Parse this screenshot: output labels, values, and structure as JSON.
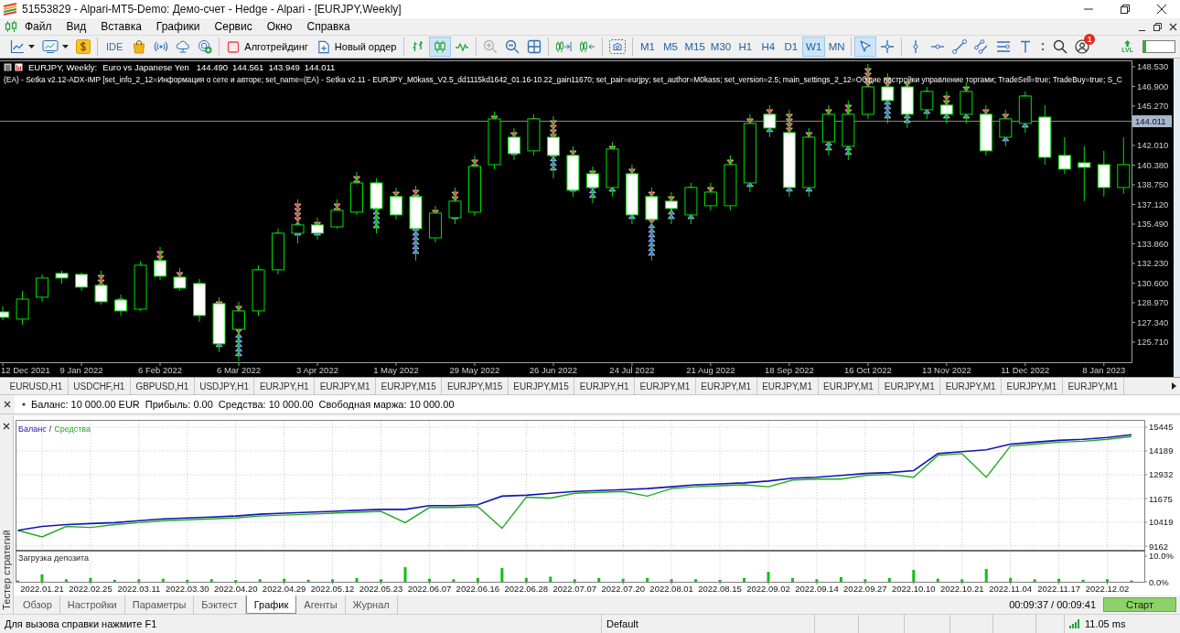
{
  "window": {
    "title": "51553829 - Alpari-MT5-Demo: Демо-счет - Hedge - Alpari - [EURJPY,Weekly]"
  },
  "menu": [
    "Файл",
    "Вид",
    "Вставка",
    "Графики",
    "Сервис",
    "Окно",
    "Справка"
  ],
  "toolbar": {
    "ide_label": "IDE",
    "algo_trading": {
      "label": "Алготрейдинг",
      "on": false
    },
    "new_order": "Новый ордер",
    "chart_types": [
      {
        "kind": "bars",
        "selected": false
      },
      {
        "kind": "candles",
        "selected": true
      },
      {
        "kind": "line",
        "selected": false
      }
    ],
    "zoom": [
      {
        "kind": "zoom_in",
        "disabled": true
      },
      {
        "kind": "zoom_out",
        "disabled": false
      }
    ],
    "timeframes": [
      {
        "label": "M1",
        "selected": false
      },
      {
        "label": "M5",
        "selected": false
      },
      {
        "label": "M15",
        "selected": false
      },
      {
        "label": "M30",
        "selected": false
      },
      {
        "label": "H1",
        "selected": false
      },
      {
        "label": "H4",
        "selected": false
      },
      {
        "label": "D1",
        "selected": false
      },
      {
        "label": "W1",
        "selected": true
      },
      {
        "label": "MN",
        "selected": false
      }
    ],
    "tools": [
      {
        "kind": "cursor",
        "selected": true
      },
      {
        "kind": "crosshair",
        "selected": false
      }
    ],
    "notification_badge": "1",
    "lvl_label": "LVL",
    "meter": {
      "level": 0.08
    }
  },
  "chart": {
    "header": {
      "symbol": "EURJPY, Weekly:",
      "description": "Euro vs Japanese Yen",
      "prices": [
        "144.490",
        "144.561",
        "143.949",
        "144.011"
      ]
    },
    "expert_info": "(EA) - Setka v2.12-ADX-IMP [set_info_2_12=Информация о сете и авторе; set_name=(EA) - Setka v2.11 - EURJPY_M0kass_V2.5_dd1115kd1642_01.16-10.22_gain11670; set_pair=eurjpy; set_author=M0kass; set_version=2.5; main_settings_2_12=Общие настройки управление торгами; TradeSell=true; TradeBuy=true; S_C",
    "trade_markers": [
      false,
      false,
      false,
      false,
      false,
      true,
      true,
      true,
      true,
      true,
      true,
      true,
      true,
      true,
      true,
      true,
      true,
      true,
      true,
      true,
      true,
      true,
      true,
      true,
      true,
      true,
      true,
      true,
      true,
      true,
      true,
      true,
      true,
      true,
      true,
      true,
      true,
      true,
      true,
      true,
      true,
      true,
      true,
      true,
      true,
      true,
      true,
      true,
      true,
      true,
      true,
      true,
      true,
      false,
      false,
      false,
      false,
      false
    ],
    "chart_data": [
      {
        "type": "candlestick",
        "x": [
          "2021-12-12",
          "2021-12-19",
          "2021-12-26",
          "2022-01-02",
          "2022-01-09",
          "2022-01-16",
          "2022-01-23",
          "2022-01-30",
          "2022-02-06",
          "2022-02-13",
          "2022-02-20",
          "2022-02-27",
          "2022-03-06",
          "2022-03-13",
          "2022-03-20",
          "2022-03-27",
          "2022-04-03",
          "2022-04-10",
          "2022-04-17",
          "2022-04-24",
          "2022-05-01",
          "2022-05-08",
          "2022-05-15",
          "2022-05-22",
          "2022-05-29",
          "2022-06-05",
          "2022-06-12",
          "2022-06-19",
          "2022-06-26",
          "2022-07-03",
          "2022-07-10",
          "2022-07-17",
          "2022-07-24",
          "2022-07-31",
          "2022-08-07",
          "2022-08-14",
          "2022-08-21",
          "2022-08-28",
          "2022-09-04",
          "2022-09-11",
          "2022-09-18",
          "2022-09-25",
          "2022-10-02",
          "2022-10-09",
          "2022-10-16",
          "2022-10-23",
          "2022-10-30",
          "2022-11-06",
          "2022-11-13",
          "2022-11-20",
          "2022-11-27",
          "2022-12-04",
          "2022-12-11",
          "2022-12-18",
          "2022-12-25",
          "2023-01-01",
          "2023-01-08",
          "2023-01-15"
        ],
        "ohlc": [
          [
            128.21,
            128.67,
            127.53,
            127.76
          ],
          [
            127.61,
            129.96,
            127.15,
            129.27
          ],
          [
            129.43,
            131.32,
            129.05,
            131.02
          ],
          [
            131.4,
            131.62,
            130.56,
            131.02
          ],
          [
            131.32,
            131.47,
            129.96,
            130.26
          ],
          [
            130.41,
            131.62,
            128.82,
            129.05
          ],
          [
            129.2,
            129.65,
            127.91,
            128.29
          ],
          [
            128.44,
            132.38,
            128.29,
            132.08
          ],
          [
            132.46,
            133.6,
            130.87,
            131.17
          ],
          [
            131.09,
            131.85,
            129.96,
            130.18
          ],
          [
            130.56,
            130.94,
            127.38,
            127.91
          ],
          [
            128.9,
            129.43,
            124.88,
            125.56
          ],
          [
            126.77,
            129.05,
            124.12,
            128.29
          ],
          [
            128.29,
            132.08,
            127.91,
            131.7
          ],
          [
            131.7,
            135.11,
            131.32,
            134.73
          ],
          [
            134.73,
            137.54,
            133.9,
            135.42
          ],
          [
            135.42,
            136.02,
            134.2,
            134.73
          ],
          [
            135.26,
            137.54,
            135.11,
            136.63
          ],
          [
            136.48,
            139.81,
            136.25,
            138.9
          ],
          [
            138.9,
            139.28,
            134.73,
            136.78
          ],
          [
            137.77,
            138.52,
            135.87,
            136.25
          ],
          [
            137.77,
            138.67,
            132.46,
            135.11
          ],
          [
            134.35,
            137.01,
            133.97,
            136.4
          ],
          [
            136.02,
            138.52,
            135.49,
            137.39
          ],
          [
            136.48,
            141.18,
            136.17,
            140.27
          ],
          [
            140.42,
            144.82,
            140.04,
            144.21
          ],
          [
            142.69,
            143.45,
            140.8,
            141.33
          ],
          [
            141.56,
            144.59,
            141.18,
            144.21
          ],
          [
            142.69,
            144.44,
            139.28,
            141.18
          ],
          [
            141.18,
            141.94,
            137.77,
            138.3
          ],
          [
            139.66,
            140.27,
            137.23,
            138.52
          ],
          [
            138.52,
            142.31,
            137.77,
            141.71
          ],
          [
            139.66,
            140.42,
            135.49,
            136.25
          ],
          [
            137.77,
            138.52,
            132.46,
            135.87
          ],
          [
            137.39,
            138.14,
            135.49,
            136.78
          ],
          [
            136.25,
            138.9,
            135.49,
            138.52
          ],
          [
            137.01,
            138.9,
            136.63,
            138.14
          ],
          [
            137.01,
            141.18,
            136.63,
            140.42
          ],
          [
            138.9,
            144.59,
            138.14,
            143.83
          ],
          [
            144.59,
            145.35,
            142.69,
            143.45
          ],
          [
            143.07,
            144.97,
            137.77,
            138.52
          ],
          [
            138.52,
            143.45,
            137.77,
            142.69
          ],
          [
            142.31,
            145.35,
            141.18,
            144.59
          ],
          [
            141.94,
            145.73,
            140.8,
            144.59
          ],
          [
            144.59,
            148.76,
            144.21,
            146.86
          ],
          [
            146.86,
            148.0,
            143.83,
            145.73
          ],
          [
            146.86,
            147.62,
            143.45,
            144.59
          ],
          [
            144.97,
            146.86,
            144.21,
            146.48
          ],
          [
            145.35,
            146.48,
            143.83,
            144.59
          ],
          [
            144.59,
            147.24,
            143.83,
            146.48
          ],
          [
            144.59,
            145.35,
            141.18,
            141.56
          ],
          [
            142.69,
            144.97,
            141.94,
            144.21
          ],
          [
            143.83,
            146.48,
            143.07,
            146.1
          ],
          [
            144.36,
            145.35,
            140.42,
            141.02
          ],
          [
            141.18,
            142.69,
            139.66,
            140.04
          ],
          [
            140.57,
            141.94,
            137.39,
            140.19
          ],
          [
            140.42,
            141.56,
            137.77,
            138.52
          ],
          [
            138.52,
            142.69,
            137.99,
            140.42
          ]
        ],
        "xlim": [
          "2021-12-11",
          "2023-01-18"
        ],
        "ylim": [
          124.0,
          149.02
        ],
        "yticks": [
          {
            "value": 148.53,
            "label": "148.530"
          },
          {
            "value": 146.9,
            "label": "146.900"
          },
          {
            "value": 145.27,
            "label": "145.270"
          },
          {
            "value": 142.01,
            "label": "142.010"
          },
          {
            "value": 140.38,
            "label": "140.380"
          },
          {
            "value": 138.75,
            "label": "138.750"
          },
          {
            "value": 137.12,
            "label": "137.120"
          },
          {
            "value": 135.49,
            "label": "135.490"
          },
          {
            "value": 133.86,
            "label": "133.860"
          },
          {
            "value": 132.23,
            "label": "132.230"
          },
          {
            "value": 130.6,
            "label": "130.600"
          },
          {
            "value": 128.97,
            "label": "128.970"
          },
          {
            "value": 127.34,
            "label": "127.340"
          },
          {
            "value": 125.71,
            "label": "125.710"
          }
        ],
        "xticks": [
          {
            "value": "2021-12-12",
            "label": "12 Dec 2021"
          },
          {
            "value": "2022-01-09",
            "label": "9 Jan 2022"
          },
          {
            "value": "2022-02-06",
            "label": "6 Feb 2022"
          },
          {
            "value": "2022-03-06",
            "label": "6 Mar 2022"
          },
          {
            "value": "2022-04-03",
            "label": "3 Apr 2022"
          },
          {
            "value": "2022-05-01",
            "label": "1 May 2022"
          },
          {
            "value": "2022-05-29",
            "label": "29 May 2022"
          },
          {
            "value": "2022-06-26",
            "label": "26 Jun 2022"
          },
          {
            "value": "2022-07-24",
            "label": "24 Jul 2022"
          },
          {
            "value": "2022-08-21",
            "label": "21 Aug 2022"
          },
          {
            "value": "2022-09-18",
            "label": "18 Sep 2022"
          },
          {
            "value": "2022-10-16",
            "label": "16 Oct 2022"
          },
          {
            "value": "2022-11-13",
            "label": "13 Nov 2022"
          },
          {
            "value": "2022-12-11",
            "label": "11 Dec 2022"
          },
          {
            "value": "2023-01-08",
            "label": "8 Jan 2023"
          }
        ],
        "ref_lines": [
          {
            "axis": "y",
            "value": 144.011,
            "label": "144.011",
            "color": "#8c8c8c"
          }
        ]
      }
    ]
  },
  "symbol_tabs": [
    "EURUSD,H1",
    "USDCHF,H1",
    "GBPUSD,H1",
    "USDJPY,H1",
    "EURJPY,H1",
    "EURJPY,M1",
    "EURJPY,M15",
    "EURJPY,M15",
    "EURJPY,M15",
    "EURJPY,H1",
    "EURJPY,M1",
    "EURJPY,M1",
    "EURJPY,M1",
    "EURJPY,M1",
    "EURJPY,M1",
    "EURJPY,M1",
    "EURJPY,M1",
    "EURJPY,M1"
  ],
  "account": [
    "Баланс: 10 000.00 EUR",
    "Прибыль: 0.00",
    "Средства: 10 000.00",
    "Свободная маржа: 10 000.00"
  ],
  "tester": {
    "title": "Тестер стратегий",
    "legend_separator": "/",
    "chart_data": [
      {
        "type": "line",
        "tick_labels": "y",
        "grid": true,
        "series": [
          {
            "name": "Баланс",
            "color": "#1414b4",
            "values": [
              10000,
              10200,
              10300,
              10350,
              10400,
              10500,
              10600,
              10650,
              10700,
              10750,
              10850,
              10900,
              10950,
              11000,
              11050,
              11100,
              11100,
              11300,
              11300,
              11350,
              11800,
              11850,
              11950,
              12050,
              12100,
              12150,
              12200,
              12300,
              12400,
              12450,
              12500,
              12600,
              12750,
              12800,
              12900,
              13000,
              13050,
              13150,
              14050,
              14150,
              14250,
              14550,
              14650,
              14750,
              14800,
              14900,
              15050
            ]
          },
          {
            "name": "Средства",
            "color": "#22aa22",
            "values": [
              10000,
              9650,
              10200,
              10150,
              10300,
              10400,
              10500,
              10550,
              10600,
              10650,
              10750,
              10800,
              10850,
              10900,
              10950,
              11000,
              10400,
              11200,
              11200,
              11250,
              10100,
              11750,
              11700,
              11950,
              12000,
              12050,
              11800,
              12200,
              12300,
              12350,
              12400,
              12300,
              12650,
              12700,
              12700,
              12900,
              12950,
              12800,
              13950,
              14050,
              12800,
              14450,
              14550,
              14650,
              14700,
              14800,
              14950
            ]
          }
        ],
        "ylim": [
          8969,
          15807
        ],
        "yticks": [
          9162,
          10419,
          11675,
          12932,
          14189,
          15445
        ]
      },
      {
        "type": "bar",
        "title": "Загрузка депозита",
        "color": "#10c010",
        "grid": true,
        "categories": [
          null,
          "2022.01.21",
          null,
          "2022.02.25",
          null,
          "2022.03.11",
          null,
          "2022.03.30",
          null,
          "2022.04.20",
          null,
          "2022.04.29",
          null,
          "2022.05.12",
          null,
          "2022.05.23",
          null,
          "2022.06.07",
          null,
          "2022.06.16",
          null,
          "2022.06.28",
          null,
          "2022.07.07",
          null,
          "2022.07.20",
          null,
          "2022.08.01",
          null,
          "2022.08.15",
          null,
          "2022.09.02",
          null,
          "2022.09.14",
          null,
          "2022.09.27",
          null,
          "2022.10.10",
          null,
          "2022.10.21",
          null,
          "2022.11.04",
          null,
          "2022.11.17",
          null,
          "2022.12.02",
          null
        ],
        "values": [
          0.5,
          2.9,
          1.0,
          1.5,
          0.8,
          1.0,
          1.2,
          0.8,
          1.0,
          0.7,
          1.0,
          1.2,
          0.8,
          1.0,
          1.5,
          1.0,
          5.7,
          1.2,
          1.0,
          1.5,
          5.4,
          1.5,
          2.0,
          1.0,
          1.5,
          1.2,
          1.5,
          1.0,
          1.0,
          0.8,
          1.5,
          3.9,
          1.5,
          1.0,
          1.8,
          1.0,
          1.5,
          4.6,
          1.2,
          1.0,
          5.0,
          1.5,
          1.0,
          1.2,
          0.8,
          1.0,
          0.5
        ],
        "ylim": [
          0,
          11.6
        ],
        "yticks": [
          {
            "value": 0,
            "label": "0.0%"
          },
          {
            "value": 10,
            "label": "10.0%"
          }
        ]
      }
    ],
    "tabs": [
      {
        "label": "Обзор",
        "selected": false
      },
      {
        "label": "Настройки",
        "selected": false
      },
      {
        "label": "Параметры",
        "selected": false
      },
      {
        "label": "Бэктест",
        "selected": false
      },
      {
        "label": "График",
        "selected": true
      },
      {
        "label": "Агенты",
        "selected": false
      },
      {
        "label": "Журнал",
        "selected": false
      }
    ],
    "timer": "00:09:37 / 00:09:41",
    "start_button": "Старт"
  },
  "status_bar": {
    "help": "Для вызова справки нажмите F1",
    "profile": "Default",
    "ping": "11.05 ms"
  }
}
